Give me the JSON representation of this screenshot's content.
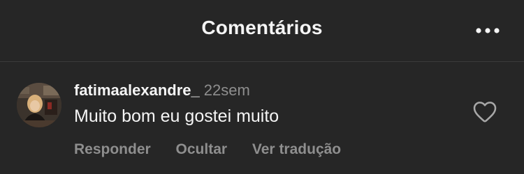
{
  "header": {
    "title": "Comentários",
    "more_icon": "more-horizontal-icon"
  },
  "comment": {
    "username": "fatimaalexandre_",
    "time": "22sem",
    "text": "Muito bom eu gostei muito",
    "actions": {
      "reply": "Responder",
      "hide": "Ocultar",
      "translate": "Ver tradução"
    },
    "like_icon": "heart-outline-icon"
  },
  "colors": {
    "background": "#262626",
    "primary_text": "#f5f5f5",
    "secondary_text": "#8e8e8e",
    "divider": "#3a3a3a"
  }
}
